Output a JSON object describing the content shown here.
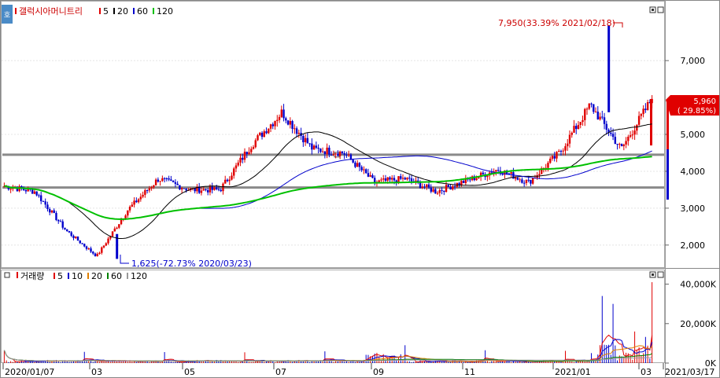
{
  "price_legend": {
    "tag": "호",
    "title": "갤럭시아머니트리",
    "items": [
      {
        "label": "5",
        "color": "#e00000"
      },
      {
        "label": "20",
        "color": "#000000"
      },
      {
        "label": "60",
        "color": "#0000cc"
      },
      {
        "label": "120",
        "color": "#00c000"
      }
    ]
  },
  "volume_legend": {
    "title": "거래량",
    "items": [
      {
        "label": "5",
        "color": "#e00000"
      },
      {
        "label": "10",
        "color": "#0000cc"
      },
      {
        "label": "20",
        "color": "#e08000"
      },
      {
        "label": "60",
        "color": "#008000"
      },
      {
        "label": "120",
        "color": "#999999"
      }
    ]
  },
  "annotations": {
    "high": "7,950(33.39% 2021/02/18)",
    "low": "1,625(-72.73% 2020/03/23)",
    "current_price": "5,960",
    "current_change": "( 29.85%)"
  },
  "chart_data": [
    {
      "type": "candlestick",
      "title": "갤럭시아머니트리",
      "ylim": [
        1400,
        8600
      ],
      "y_ticks": [
        "2,000",
        "3,000",
        "4,000",
        "5,000",
        "7,000"
      ],
      "x_ticks": [
        "2020/01/07",
        "03",
        "05",
        "07",
        "09",
        "11",
        "2021/01",
        "03",
        "2021/03/17"
      ],
      "high_point": {
        "date": "2021/02/18",
        "value": 7950,
        "change_pct": 33.39
      },
      "low_point": {
        "date": "2020/03/23",
        "value": 1625,
        "change_pct": -72.73
      },
      "last": {
        "date": "2021/03/17",
        "value": 5960,
        "change_pct": 29.85
      },
      "horizontal_lines": [
        4450,
        3560
      ],
      "key_prices": [
        {
          "x": "2020/01/07",
          "close": 3600
        },
        {
          "x": "2020/02",
          "close": 3450
        },
        {
          "x": "2020/03",
          "close": 2400
        },
        {
          "x": "2020/03/23",
          "close": 1700
        },
        {
          "x": "2020/04",
          "close": 2950
        },
        {
          "x": "2020/05",
          "close": 3800
        },
        {
          "x": "2020/06",
          "close": 3500
        },
        {
          "x": "2020/07",
          "close": 3500
        },
        {
          "x": "2020/07 mid",
          "close": 4700
        },
        {
          "x": "2020/08",
          "close": 5600
        },
        {
          "x": "2020/08 mid",
          "close": 4600
        },
        {
          "x": "2020/09",
          "close": 4500
        },
        {
          "x": "2020/09 mid",
          "close": 3700
        },
        {
          "x": "2020/10",
          "close": 3800
        },
        {
          "x": "2020/11",
          "close": 3450
        },
        {
          "x": "2020/12",
          "close": 3750
        },
        {
          "x": "2021/01",
          "close": 4050
        },
        {
          "x": "2021/01 mid",
          "close": 3700
        },
        {
          "x": "2021/02",
          "close": 4500
        },
        {
          "x": "2021/02/18",
          "close": 5800
        },
        {
          "x": "2021/03",
          "close": 4600
        },
        {
          "x": "2021/03/17",
          "close": 5960
        }
      ],
      "series": [
        {
          "name": "5",
          "color": "#e00000"
        },
        {
          "name": "20",
          "color": "#000000"
        },
        {
          "name": "60",
          "color": "#0000cc"
        },
        {
          "name": "120",
          "color": "#00c000"
        }
      ]
    },
    {
      "type": "bar",
      "title": "거래량",
      "ylim": [
        0,
        47000
      ],
      "y_ticks": [
        "0K",
        "20,000K",
        "40,000K"
      ],
      "series": [
        {
          "name": "5",
          "color": "#e00000"
        },
        {
          "name": "10",
          "color": "#0000cc"
        },
        {
          "name": "20",
          "color": "#e08000"
        },
        {
          "name": "60",
          "color": "#008000"
        },
        {
          "name": "120",
          "color": "#999999"
        }
      ]
    }
  ]
}
